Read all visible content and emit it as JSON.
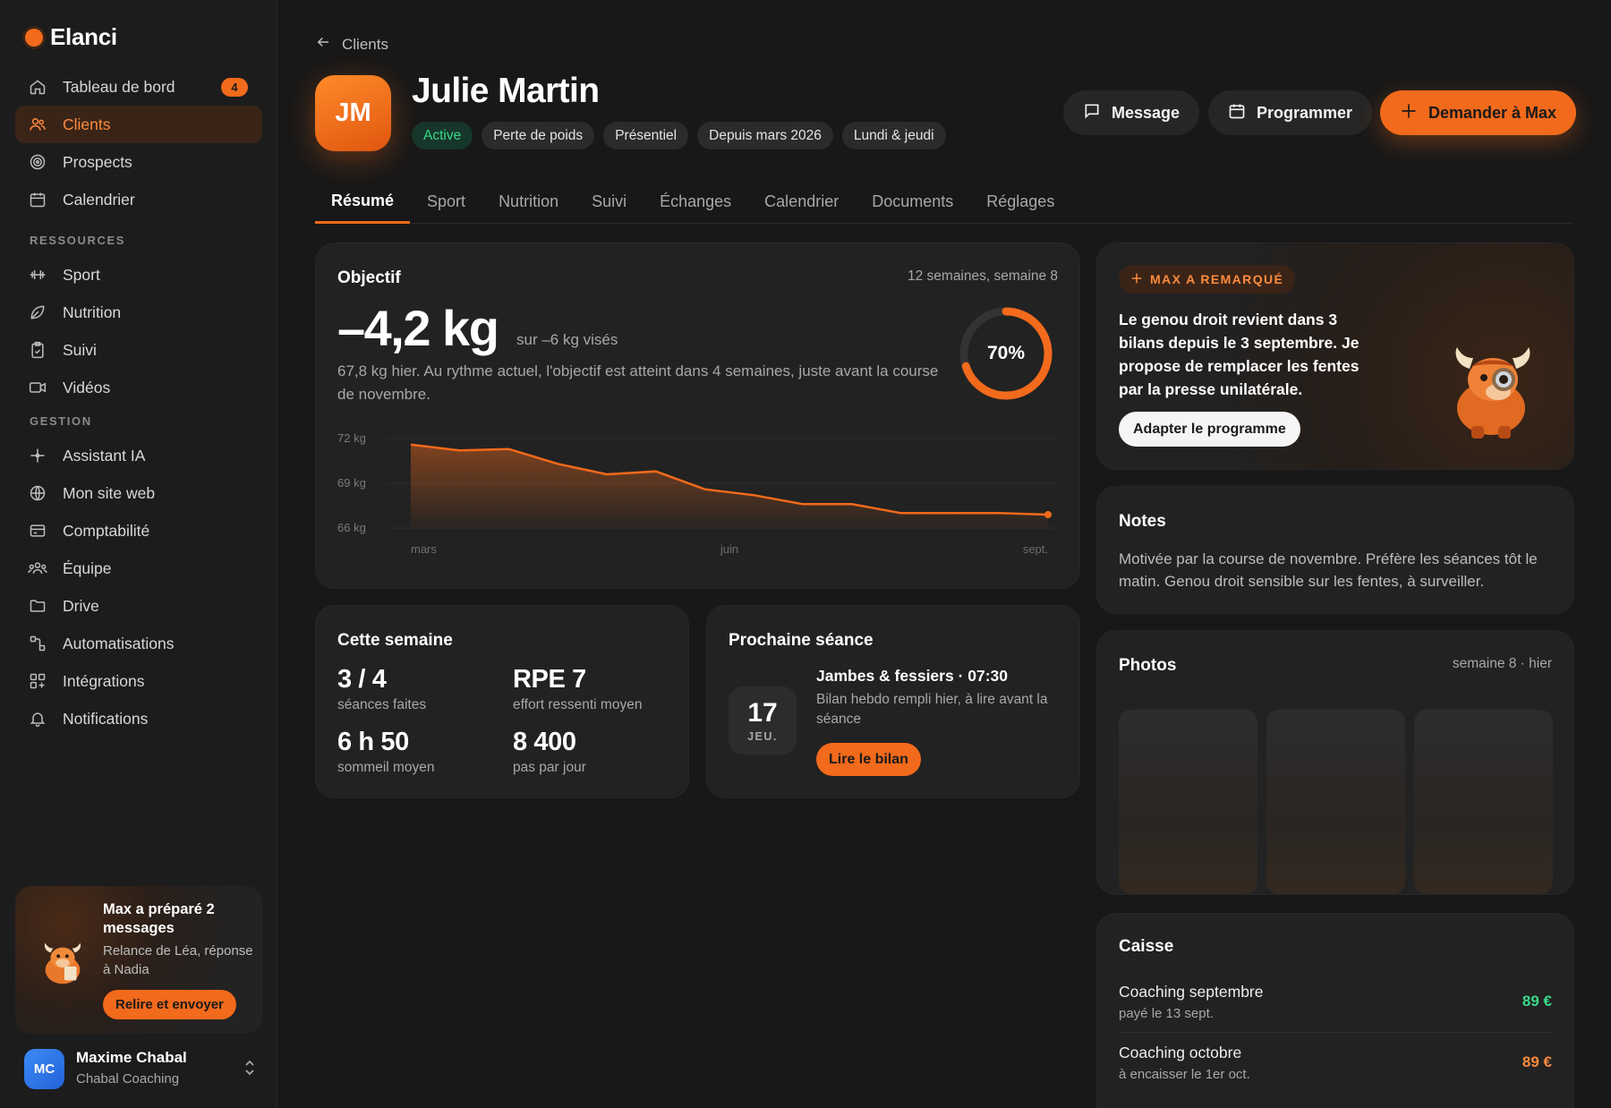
{
  "app": {
    "name": "Elanci",
    "brand_color": "#F26A1B"
  },
  "sidebar": {
    "main_items": [
      {
        "label": "Tableau de bord",
        "icon": "home-icon",
        "badge": "4"
      },
      {
        "label": "Clients",
        "icon": "users-icon",
        "active": true
      },
      {
        "label": "Prospects",
        "icon": "target-icon"
      },
      {
        "label": "Calendrier",
        "icon": "calendar-icon"
      }
    ],
    "sections": [
      {
        "title": "RESSOURCES",
        "items": [
          {
            "label": "Sport",
            "icon": "dumbbell-icon"
          },
          {
            "label": "Nutrition",
            "icon": "leaf-icon"
          },
          {
            "label": "Suivi",
            "icon": "clipboard-check-icon"
          },
          {
            "label": "Vidéos",
            "icon": "video-icon"
          }
        ]
      },
      {
        "title": "GESTION",
        "items": [
          {
            "label": "Assistant IA",
            "icon": "sparkle-icon"
          },
          {
            "label": "Mon site web",
            "icon": "globe-icon"
          },
          {
            "label": "Comptabilité",
            "icon": "credit-card-icon"
          },
          {
            "label": "Équipe",
            "icon": "team-icon"
          },
          {
            "label": "Drive",
            "icon": "folder-icon"
          },
          {
            "label": "Automatisations",
            "icon": "workflow-icon"
          },
          {
            "label": "Intégrations",
            "icon": "grid-plus-icon"
          },
          {
            "label": "Notifications",
            "icon": "bell-icon"
          }
        ]
      }
    ],
    "promo": {
      "title": "Max a préparé 2 messages",
      "subtitle": "Relance de Léa, réponse à Nadia",
      "button": "Relire et envoyer"
    },
    "user": {
      "initials": "MC",
      "name": "Maxime Chabal",
      "org": "Chabal Coaching"
    }
  },
  "header": {
    "back_label": "Clients",
    "initials": "JM",
    "name": "Julie Martin",
    "tags": [
      "Active",
      "Perte de poids",
      "Présentiel",
      "Depuis mars 2026",
      "Lundi & jeudi"
    ],
    "actions": {
      "message": "Message",
      "schedule": "Programmer",
      "ask_max": "Demander à Max"
    }
  },
  "tabs": [
    "Résumé",
    "Sport",
    "Nutrition",
    "Suivi",
    "Échanges",
    "Calendrier",
    "Documents",
    "Réglages"
  ],
  "active_tab": "Résumé",
  "objective": {
    "title": "Objectif",
    "meta": "12 semaines, semaine 8",
    "value": "–4,2 kg",
    "target": "sur –6 kg visés",
    "description": "67,8 kg hier. Au rythme actuel, l'objectif est atteint dans 4 semaines, juste avant la course de novembre.",
    "progress_label": "70%",
    "progress": 0.7
  },
  "chart_data": {
    "type": "area",
    "y_ticks": [
      "72 kg",
      "69 kg",
      "66 kg"
    ],
    "y_tick_values": [
      72,
      69,
      66
    ],
    "x_ticks": [
      "mars",
      "juin",
      "sept."
    ],
    "ylim": [
      66,
      72
    ],
    "series": [
      {
        "values": [
          71.6,
          71.2,
          71.3,
          70.3,
          69.6,
          69.8,
          68.6,
          68.2,
          67.6,
          67.6,
          67.0,
          67.0,
          67.0,
          66.9
        ]
      }
    ]
  },
  "week": {
    "title": "Cette semaine",
    "stats": [
      {
        "value": "3 / 4",
        "label": "séances faites"
      },
      {
        "value": "RPE 7",
        "label": "effort ressenti moyen"
      },
      {
        "value": "6 h 50",
        "label": "sommeil moyen"
      },
      {
        "value": "8 400",
        "label": "pas par jour"
      }
    ]
  },
  "next_session": {
    "title": "Prochaine séance",
    "day": "17",
    "weekday": "JEU.",
    "name": "Jambes & fessiers · 07:30",
    "note": "Bilan hebdo rempli hier, à lire avant la séance",
    "button": "Lire le bilan"
  },
  "max_insight": {
    "pill": "MAX A REMARQUÉ",
    "text": "Le genou droit revient dans 3 bilans depuis le 3 septembre. Je propose de remplacer les fentes par la presse unilatérale.",
    "button": "Adapter le programme"
  },
  "notes": {
    "title": "Notes",
    "text": "Motivée par la course de novembre. Préfère les séances tôt le matin. Genou droit sensible sur les fentes, à surveiller."
  },
  "photos": {
    "title": "Photos",
    "meta": "semaine 8 · hier",
    "count": 3
  },
  "cash": {
    "title": "Caisse",
    "rows": [
      {
        "title": "Coaching septembre",
        "sub": "payé le 13 sept.",
        "amount": "89 €",
        "color": "#39D98A"
      },
      {
        "title": "Coaching octobre",
        "sub": "à encaisser le 1er oct.",
        "amount": "89 €",
        "color": "#FF8A3D"
      }
    ]
  }
}
